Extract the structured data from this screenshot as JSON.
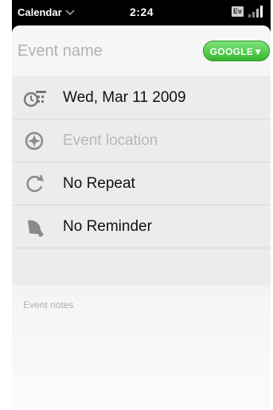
{
  "status_bar": {
    "app_name": "Calendar",
    "time": "2:24",
    "carrier_badge": "Ev"
  },
  "event": {
    "name_placeholder": "Event name",
    "name_value": "",
    "calendar_button": "GOOGLE▼",
    "date": "Wed, Mar 11 2009",
    "location_placeholder": "Event location",
    "repeat": "No Repeat",
    "reminder": "No Reminder",
    "notes_placeholder": "Event notes"
  },
  "colors": {
    "accent_green": "#3fbf38",
    "background": "#f2f2f2",
    "status_bar": "#000000"
  },
  "icons": {
    "app_menu": "chevron-down-icon",
    "signal": "signal-bars-icon",
    "date": "clock-calendar-icon",
    "location": "compass-icon",
    "repeat": "repeat-icon",
    "reminder": "bell-icon"
  }
}
